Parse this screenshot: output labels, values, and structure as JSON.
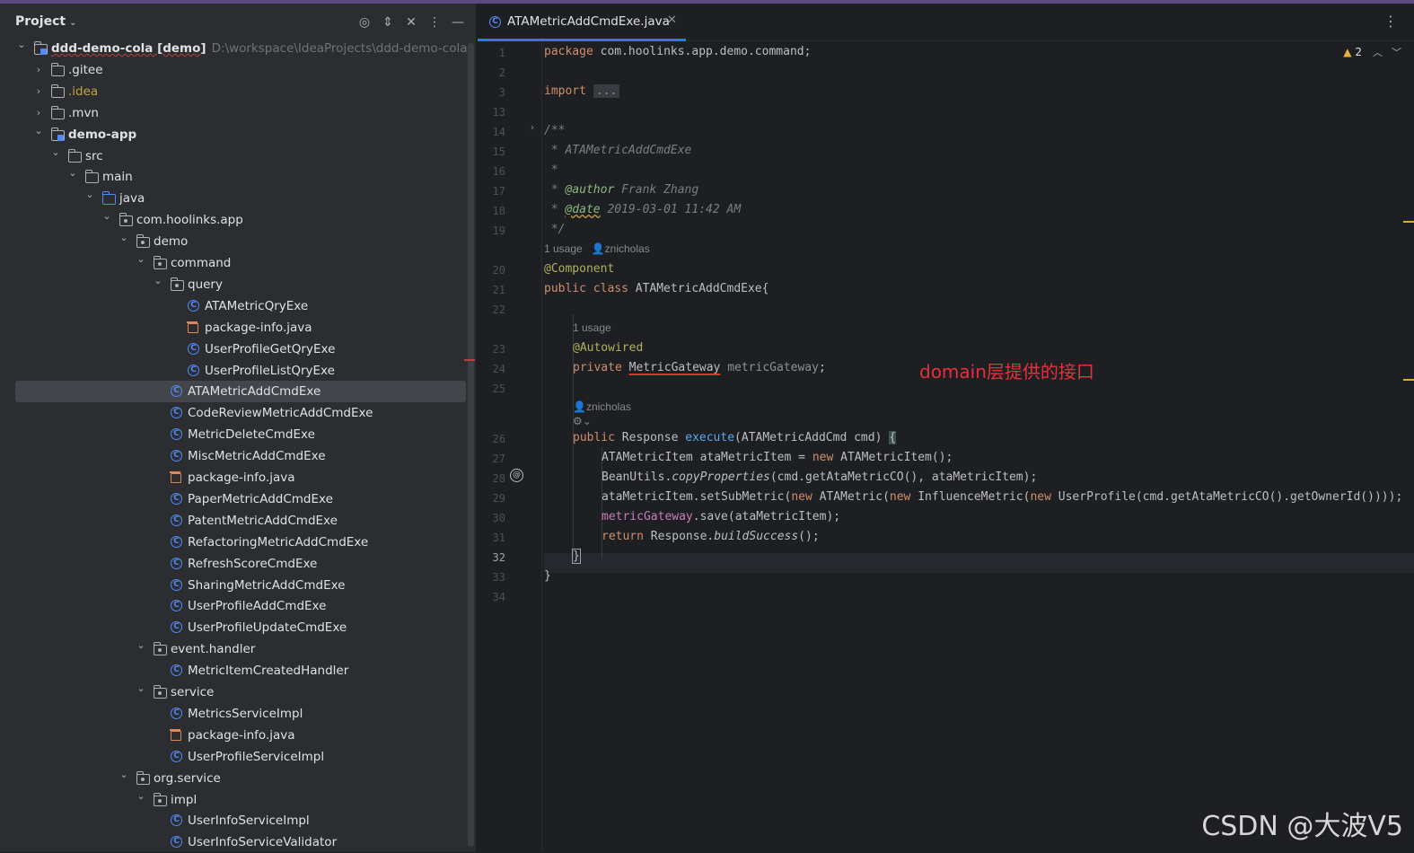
{
  "project": {
    "title": "Project",
    "header_icons": [
      "locate-icon",
      "expand-icon",
      "collapse-icon",
      "more-icon",
      "minimize-icon"
    ],
    "tree": [
      {
        "depth": 0,
        "arrow": "v",
        "icon": "module",
        "label": "ddd-demo-cola [demo]",
        "path": "D:\\workspace\\IdeaProjects\\ddd-demo-cola",
        "bold": true
      },
      {
        "depth": 1,
        "arrow": ">",
        "icon": "folder",
        "label": ".gitee"
      },
      {
        "depth": 1,
        "arrow": ">",
        "icon": "folder",
        "label": ".idea",
        "yellow": true
      },
      {
        "depth": 1,
        "arrow": ">",
        "icon": "folder",
        "label": ".mvn"
      },
      {
        "depth": 1,
        "arrow": "v",
        "icon": "module",
        "label": "demo-app",
        "bold": true
      },
      {
        "depth": 2,
        "arrow": "v",
        "icon": "folder",
        "label": "src"
      },
      {
        "depth": 3,
        "arrow": "v",
        "icon": "folder",
        "label": "main"
      },
      {
        "depth": 4,
        "arrow": "v",
        "icon": "srcf",
        "label": "java"
      },
      {
        "depth": 5,
        "arrow": "v",
        "icon": "pkg",
        "label": "com.hoolinks.app"
      },
      {
        "depth": 6,
        "arrow": "v",
        "icon": "pkg",
        "label": "demo"
      },
      {
        "depth": 7,
        "arrow": "v",
        "icon": "pkg",
        "label": "command"
      },
      {
        "depth": 8,
        "arrow": "v",
        "icon": "pkg",
        "label": "query"
      },
      {
        "depth": 9,
        "arrow": "",
        "icon": "cls",
        "label": "ATAMetricQryExe"
      },
      {
        "depth": 9,
        "arrow": "",
        "icon": "pinfo",
        "label": "package-info.java"
      },
      {
        "depth": 9,
        "arrow": "",
        "icon": "cls",
        "label": "UserProfileGetQryExe"
      },
      {
        "depth": 9,
        "arrow": "",
        "icon": "cls",
        "label": "UserProfileListQryExe"
      },
      {
        "depth": 8,
        "arrow": "",
        "icon": "cls",
        "label": "ATAMetricAddCmdExe",
        "selected": true
      },
      {
        "depth": 8,
        "arrow": "",
        "icon": "cls",
        "label": "CodeReviewMetricAddCmdExe"
      },
      {
        "depth": 8,
        "arrow": "",
        "icon": "cls",
        "label": "MetricDeleteCmdExe"
      },
      {
        "depth": 8,
        "arrow": "",
        "icon": "cls",
        "label": "MiscMetricAddCmdExe"
      },
      {
        "depth": 8,
        "arrow": "",
        "icon": "pinfo",
        "label": "package-info.java"
      },
      {
        "depth": 8,
        "arrow": "",
        "icon": "cls",
        "label": "PaperMetricAddCmdExe"
      },
      {
        "depth": 8,
        "arrow": "",
        "icon": "cls",
        "label": "PatentMetricAddCmdExe"
      },
      {
        "depth": 8,
        "arrow": "",
        "icon": "cls",
        "label": "RefactoringMetricAddCmdExe"
      },
      {
        "depth": 8,
        "arrow": "",
        "icon": "cls",
        "label": "RefreshScoreCmdExe"
      },
      {
        "depth": 8,
        "arrow": "",
        "icon": "cls",
        "label": "SharingMetricAddCmdExe"
      },
      {
        "depth": 8,
        "arrow": "",
        "icon": "cls",
        "label": "UserProfileAddCmdExe"
      },
      {
        "depth": 8,
        "arrow": "",
        "icon": "cls",
        "label": "UserProfileUpdateCmdExe"
      },
      {
        "depth": 7,
        "arrow": "v",
        "icon": "pkg",
        "label": "event.handler"
      },
      {
        "depth": 8,
        "arrow": "",
        "icon": "cls",
        "label": "MetricItemCreatedHandler"
      },
      {
        "depth": 7,
        "arrow": "v",
        "icon": "pkg",
        "label": "service"
      },
      {
        "depth": 8,
        "arrow": "",
        "icon": "cls",
        "label": "MetricsServiceImpl"
      },
      {
        "depth": 8,
        "arrow": "",
        "icon": "pinfo",
        "label": "package-info.java"
      },
      {
        "depth": 8,
        "arrow": "",
        "icon": "cls",
        "label": "UserProfileServiceImpl"
      },
      {
        "depth": 6,
        "arrow": "v",
        "icon": "pkg",
        "label": "org.service"
      },
      {
        "depth": 7,
        "arrow": "v",
        "icon": "pkg",
        "label": "impl"
      },
      {
        "depth": 8,
        "arrow": "",
        "icon": "cls",
        "label": "UserInfoServiceImpl"
      },
      {
        "depth": 8,
        "arrow": "",
        "icon": "cls",
        "label": "UserInfoServiceValidator"
      }
    ]
  },
  "editor": {
    "tab_label": "ATAMetricAddCmdExe.java",
    "warnings": "2",
    "line_numbers": [
      "1",
      "2",
      "3",
      "13",
      "14",
      "15",
      "16",
      "17",
      "18",
      "19",
      "20",
      "21",
      "22",
      "23",
      "24",
      "25",
      "26",
      "27",
      "28",
      "29",
      "30",
      "31",
      "32",
      "33",
      "34"
    ],
    "hints": {
      "usage1": "1 usage",
      "author1": "znicholas",
      "usage2": "1 usage",
      "author2": "znicholas"
    },
    "code": {
      "l1_kw": "package",
      "l1_rest": " com.hoolinks.app.demo.command;",
      "l3_kw": "import",
      "l3_fold": "...",
      "l14": "/**",
      "l15": " * ATAMetricAddCmdExe",
      "l16": " *",
      "l17_pre": " * ",
      "l17_tag": "@author",
      "l17_rest": " Frank Zhang",
      "l18_pre": " * ",
      "l18_tag": "@date",
      "l18_rest": " 2019-03-01 11:42 AM",
      "l19": " */",
      "l20": "@Component",
      "l21_kw": "public class",
      "l21_rest": " ATAMetricAddCmdExe{",
      "l23": "@Autowired",
      "l24_kw": "private",
      "l24_type": "MetricGateway",
      "l24_field": "metricGateway",
      "l24_end": ";",
      "l26_kw": "public",
      "l26_a": " Response ",
      "l26_fn": "execute",
      "l26_b": "(ATAMetricAddCmd cmd) ",
      "l26_brace": "{",
      "l27_a": "ATAMetricItem ataMetricItem = ",
      "l27_kw": "new",
      "l27_b": " ATAMetricItem();",
      "l28_a": "BeanUtils.",
      "l28_i": "copyProperties",
      "l28_b": "(cmd.getAtaMetricCO(), ataMetricItem);",
      "l29_a": "ataMetricItem.setSubMetric(",
      "l29_k1": "new",
      "l29_b": " ATAMetric(",
      "l29_k2": "new",
      "l29_c": " InfluenceMetric(",
      "l29_k3": "new",
      "l29_d": " UserProfile(cmd.getAtaMetricCO().getOwnerId())));",
      "l30_fld": "metricGateway",
      "l30_rest": ".save(ataMetricItem);",
      "l31_kw": "return",
      "l31_a": " Response.",
      "l31_i": "buildSuccess",
      "l31_b": "();",
      "l32": "}",
      "l33": "}"
    },
    "annotation_note": "domain层提供的接口",
    "watermark": "CSDN @大波V5"
  }
}
